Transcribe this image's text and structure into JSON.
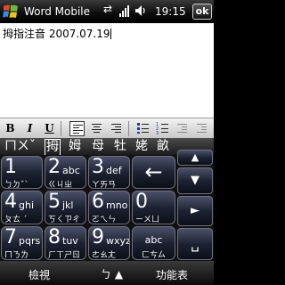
{
  "title_bar": {
    "app_title": "Word Mobile",
    "time": "19:15",
    "ok_label": "ok"
  },
  "document": {
    "text": "拇指注音 2007.07.19"
  },
  "toolbar": {
    "bold": "B",
    "italic": "I",
    "underline": "U",
    "active_button": "align-left"
  },
  "candidates": {
    "input": "ㄇㄨˇ",
    "items": [
      "拇",
      "姆",
      "母",
      "牡",
      "姥",
      "畝"
    ],
    "selected_index": 0
  },
  "keypad": {
    "keys": [
      {
        "num": "1",
        "letters": "",
        "zhuyin": "ㄅㄉˇˋ"
      },
      {
        "num": "2",
        "letters": "abc",
        "zhuyin": "ㄍㄐㄓ"
      },
      {
        "num": "3",
        "letters": "def",
        "zhuyin": "ㄚㄞㄢ"
      },
      {
        "num": "4",
        "letters": "ghi",
        "zhuyin": "ㄆㄊ ˊ"
      },
      {
        "num": "5",
        "letters": "jkl",
        "zhuyin": "ㄎㄑㄗㄔ"
      },
      {
        "num": "6",
        "letters": "mno",
        "zhuyin": "ㄛㄟㄣ"
      },
      {
        "num": "7",
        "letters": "pqrs",
        "zhuyin": "ㄇㄋㄌ"
      },
      {
        "num": "8",
        "letters": "tuv",
        "zhuyin": "ㄏㄒㄕㄖ"
      },
      {
        "num": "9",
        "letters": "wxyz",
        "zhuyin": "ㄜㄠㄤ"
      }
    ],
    "zero": {
      "num": "0",
      "zhuyin": "ㄧㄨㄩ"
    },
    "symbol_key": {
      "letters": "abc",
      "zhuyin": "ㄈㄘㄙ"
    },
    "backspace": "←",
    "side_keys": [
      "▲",
      "▼",
      "►",
      "␣"
    ]
  },
  "soft_keys": {
    "left": "檢視",
    "center": "ㄅ ▲",
    "right": "功能表"
  }
}
